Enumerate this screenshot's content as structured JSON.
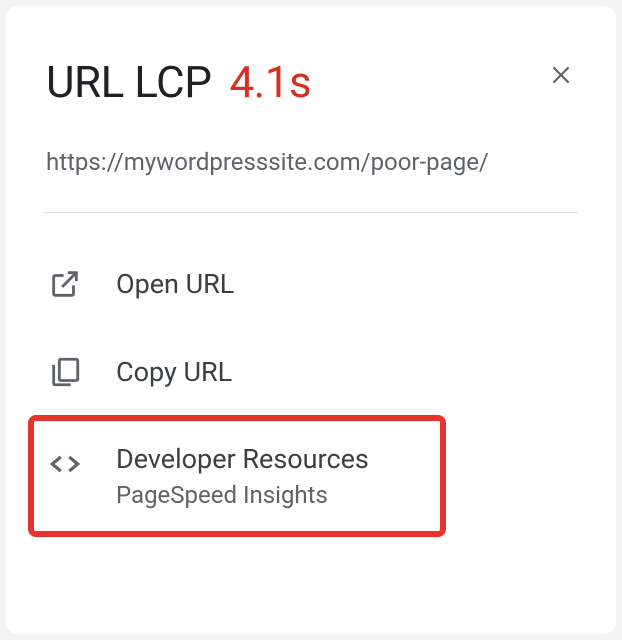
{
  "header": {
    "title": "URL LCP",
    "metric": "4.1s"
  },
  "url": "https://mywordpresssite.com/poor-page/",
  "actions": {
    "open": "Open URL",
    "copy": "Copy URL",
    "dev": {
      "label": "Developer Resources",
      "sublabel": "PageSpeed Insights"
    }
  }
}
